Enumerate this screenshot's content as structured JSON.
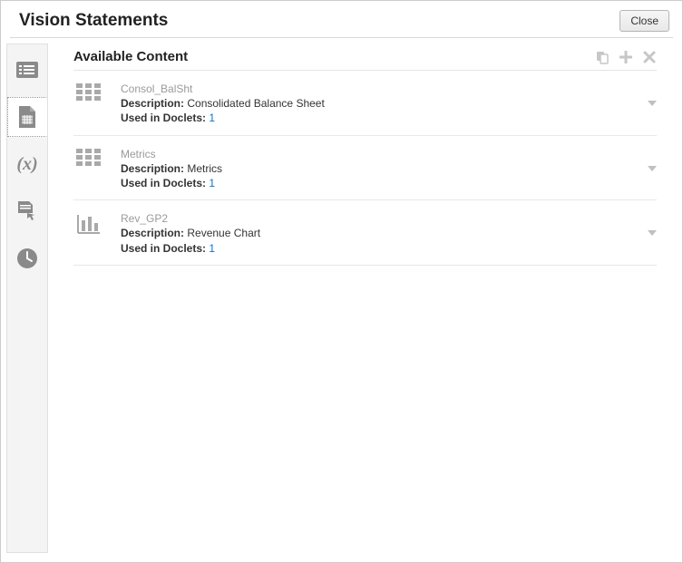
{
  "header": {
    "title": "Vision Statements",
    "close_label": "Close"
  },
  "section": {
    "title": "Available Content",
    "description_label": "Description:",
    "used_in_label": "Used in Doclets:"
  },
  "items": [
    {
      "name": "Consol_BalSht",
      "description": "Consolidated Balance Sheet",
      "used_in_doclets": "1",
      "icon": "grid"
    },
    {
      "name": "Metrics",
      "description": "Metrics",
      "used_in_doclets": "1",
      "icon": "grid"
    },
    {
      "name": "Rev_GP2",
      "description": "Revenue Chart",
      "used_in_doclets": "1",
      "icon": "chart"
    }
  ]
}
